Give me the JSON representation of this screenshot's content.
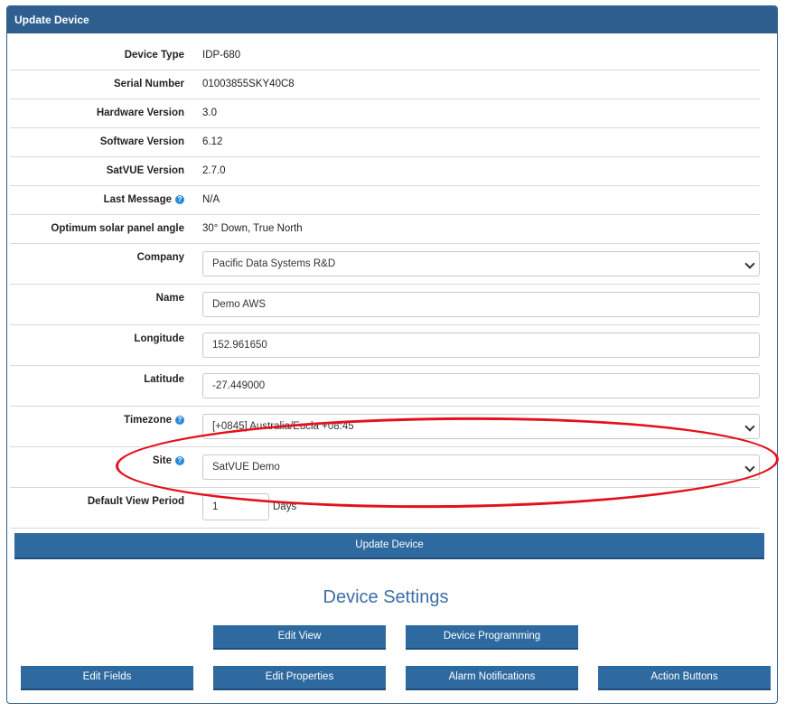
{
  "panel": {
    "title": "Update Device"
  },
  "info_rows": [
    {
      "label": "Device Type",
      "value": "IDP-680",
      "help": false
    },
    {
      "label": "Serial Number",
      "value": "01003855SKY40C8",
      "help": false
    },
    {
      "label": "Hardware Version",
      "value": "3.0",
      "help": false
    },
    {
      "label": "Software Version",
      "value": "6.12",
      "help": false
    },
    {
      "label": "SatVUE Version",
      "value": "2.7.0",
      "help": false
    },
    {
      "label": "Last Message",
      "value": "N/A",
      "help": true
    },
    {
      "label": "Optimum solar panel angle",
      "value": "30° Down, True North",
      "help": false
    }
  ],
  "form": {
    "company": {
      "label": "Company",
      "value": "Pacific Data Systems R&D"
    },
    "name": {
      "label": "Name",
      "value": "Demo AWS"
    },
    "longitude": {
      "label": "Longitude",
      "value": "152.961650"
    },
    "latitude": {
      "label": "Latitude",
      "value": "-27.449000"
    },
    "timezone": {
      "label": "Timezone",
      "value": "[+0845] Australia/Eucla +08:45"
    },
    "site": {
      "label": "Site",
      "value": "SatVUE Demo"
    },
    "default_view_period": {
      "label": "Default View Period",
      "value": "1",
      "unit": "Days"
    }
  },
  "update_button": "Update Device",
  "device_settings": {
    "title": "Device Settings",
    "buttons_row1": [
      "Edit View",
      "Device Programming"
    ],
    "buttons_row2": [
      "Edit Fields",
      "Edit Properties",
      "Alarm Notifications",
      "Action Buttons"
    ]
  },
  "colors": {
    "header": "#2e5f8f",
    "button": "#2e6aa0",
    "annotation": "#e3111b",
    "help_icon": "#2a8ad8"
  },
  "icons": {
    "help": "help-circle-icon",
    "dropdown": "chevron-down-icon"
  }
}
